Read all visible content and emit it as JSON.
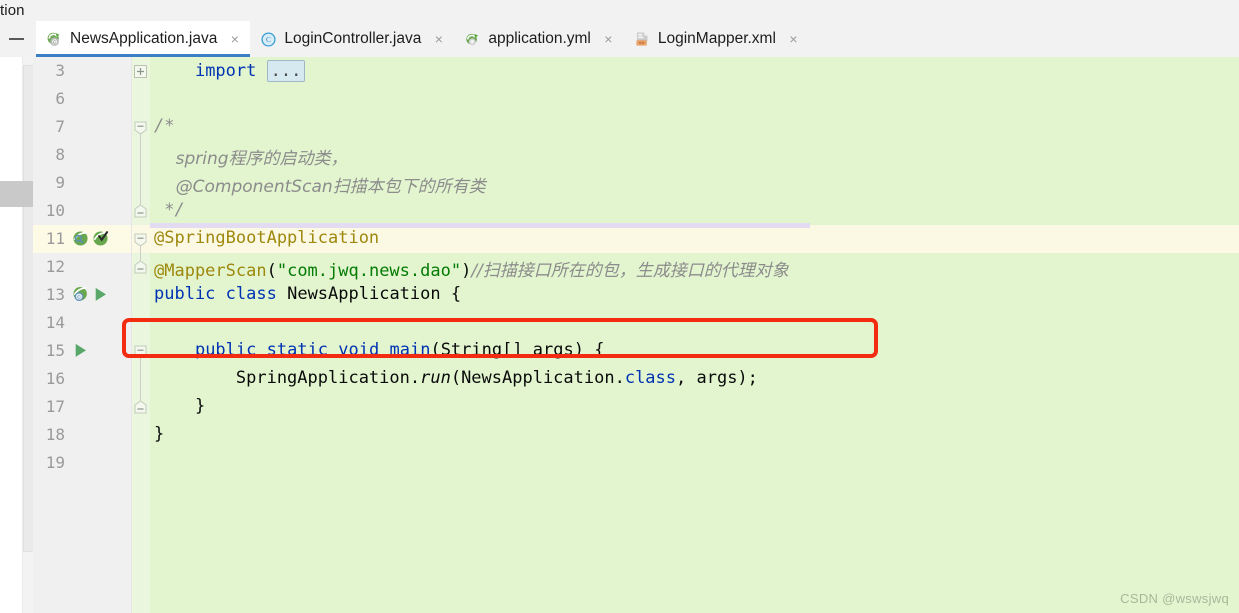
{
  "window": {
    "partial_title": "tion"
  },
  "tabbar": {
    "collapse_label": "—",
    "close_glyph": "×",
    "tabs": [
      {
        "label": "NewsApplication.java",
        "icon": "spring-boot-class-icon",
        "active": true,
        "closable": true
      },
      {
        "label": "LoginController.java",
        "icon": "java-class-icon",
        "active": false,
        "closable": true
      },
      {
        "label": "application.yml",
        "icon": "spring-yaml-icon",
        "active": false,
        "closable": true
      },
      {
        "label": "LoginMapper.xml",
        "icon": "mybatis-xml-icon",
        "active": false,
        "closable": true
      }
    ]
  },
  "editor": {
    "background": "#e2f5cf",
    "highlight_row_background": "#fbf8e3",
    "annotation_box_color": "#f32b10",
    "lines": [
      {
        "number": "3",
        "fold": "plus",
        "gutter_icons": [],
        "segments": [
          {
            "text": "    ",
            "cls": "pl"
          },
          {
            "text": "import",
            "cls": "kw"
          },
          {
            "text": " ",
            "cls": "pl"
          },
          {
            "text": "...",
            "cls": "boxdots"
          }
        ]
      },
      {
        "number": "6",
        "fold": "none",
        "gutter_icons": [],
        "segments": []
      },
      {
        "number": "7",
        "fold": "collapse-top",
        "gutter_icons": [],
        "segments": [
          {
            "text": "/*",
            "cls": "cmtm"
          }
        ]
      },
      {
        "number": "8",
        "fold": "bar",
        "gutter_icons": [],
        "segments": [
          {
            "text": "    spring程序的启动类，",
            "cls": "cmt"
          }
        ]
      },
      {
        "number": "9",
        "fold": "bar",
        "gutter_icons": [],
        "segments": [
          {
            "text": "    @ComponentScan扫描本包下的所有类",
            "cls": "cmt"
          }
        ]
      },
      {
        "number": "10",
        "fold": "collapse-bottom",
        "gutter_icons": [],
        "segments": [
          {
            "text": " */",
            "cls": "cmtm"
          }
        ]
      },
      {
        "number": "11",
        "fold": "collapse-top",
        "highlight": true,
        "band": true,
        "gutter_icons": [
          "spring-search-bean-icon",
          "spring-check-bean-icon"
        ],
        "segments": [
          {
            "text": "@SpringBootApplication",
            "cls": "ann"
          }
        ]
      },
      {
        "number": "12",
        "fold": "collapse-bottom",
        "boxed": true,
        "gutter_icons": [],
        "segments": [
          {
            "text": "@MapperScan",
            "cls": "ann"
          },
          {
            "text": "(",
            "cls": "pl"
          },
          {
            "text": "\"com.jwq.news.dao\"",
            "cls": "str"
          },
          {
            "text": ")",
            "cls": "pl"
          },
          {
            "text": "//扫描接口所在的包，生成接口的代理对象",
            "cls": "cmt"
          }
        ]
      },
      {
        "number": "13",
        "fold": "none",
        "gutter_icons": [
          "spring-bean-icon",
          "run-gutter-icon"
        ],
        "segments": [
          {
            "text": "public",
            "cls": "kw"
          },
          {
            "text": " ",
            "cls": "pl"
          },
          {
            "text": "class",
            "cls": "kw"
          },
          {
            "text": " NewsApplication {",
            "cls": "pl"
          }
        ]
      },
      {
        "number": "14",
        "fold": "none",
        "gutter_icons": [],
        "segments": []
      },
      {
        "number": "15",
        "fold": "collapse-top",
        "gutter_icons": [
          "run-gutter-icon"
        ],
        "segments": [
          {
            "text": "    ",
            "cls": "pl"
          },
          {
            "text": "public",
            "cls": "kw"
          },
          {
            "text": " ",
            "cls": "pl"
          },
          {
            "text": "static",
            "cls": "kw"
          },
          {
            "text": " ",
            "cls": "pl"
          },
          {
            "text": "void",
            "cls": "kw"
          },
          {
            "text": " ",
            "cls": "pl"
          },
          {
            "text": "main",
            "cls": "blue"
          },
          {
            "text": "(String[] args) {",
            "cls": "pl"
          }
        ]
      },
      {
        "number": "16",
        "fold": "bar",
        "gutter_icons": [],
        "segments": [
          {
            "text": "        SpringApplication.",
            "cls": "pl"
          },
          {
            "text": "run",
            "cls": "mcall"
          },
          {
            "text": "(NewsApplication.",
            "cls": "pl"
          },
          {
            "text": "class",
            "cls": "kw"
          },
          {
            "text": ", args);",
            "cls": "pl"
          }
        ]
      },
      {
        "number": "17",
        "fold": "collapse-bottom",
        "gutter_icons": [],
        "segments": [
          {
            "text": "    }",
            "cls": "pl"
          }
        ]
      },
      {
        "number": "18",
        "fold": "none",
        "gutter_icons": [],
        "segments": [
          {
            "text": "}",
            "cls": "pl"
          }
        ]
      },
      {
        "number": "19",
        "fold": "none",
        "gutter_icons": [],
        "segments": []
      }
    ]
  },
  "watermark": {
    "text": "CSDN @wswsjwq"
  }
}
